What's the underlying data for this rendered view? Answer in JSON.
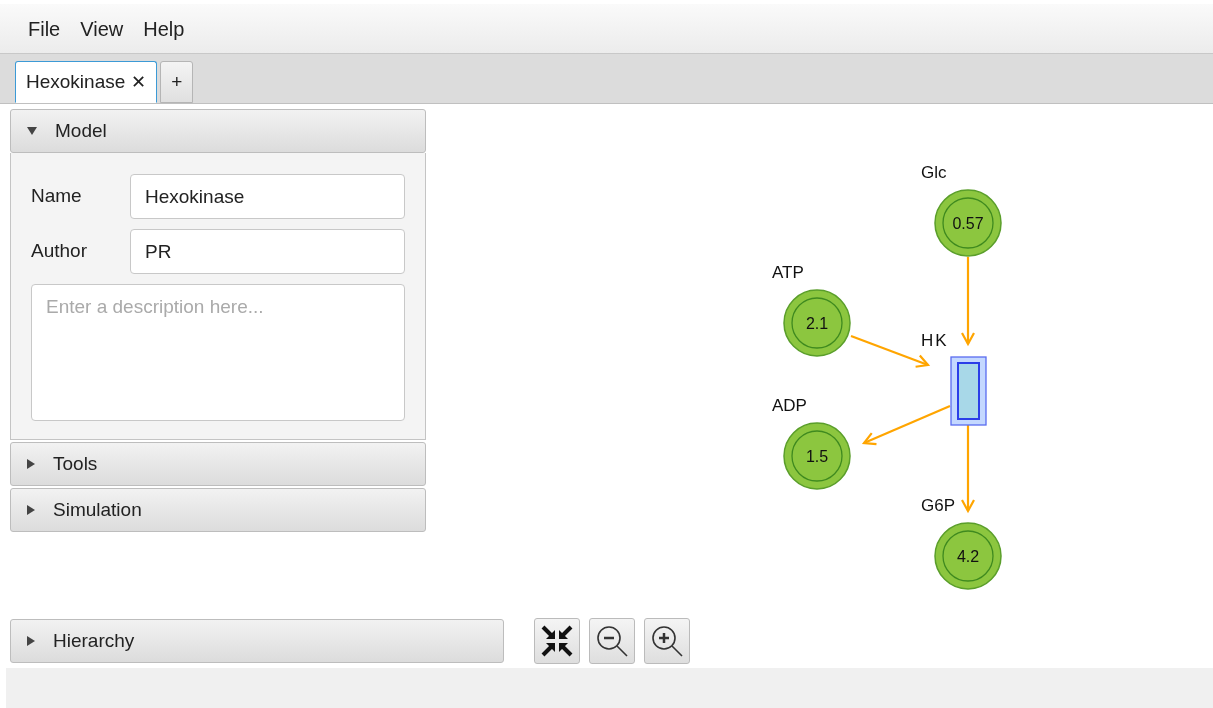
{
  "menu": [
    "File",
    "View",
    "Help"
  ],
  "tabs": [
    {
      "label": "Hexokinase",
      "close": "✕",
      "selected": true
    },
    {
      "label": "+",
      "selected": false
    }
  ],
  "panels": [
    {
      "title": "Model",
      "expanded": true
    },
    {
      "title": "Tools",
      "expanded": false
    },
    {
      "title": "Simulation",
      "expanded": false
    }
  ],
  "model": {
    "name_label": "Name",
    "name_value": "Hexokinase",
    "author_label": "Author",
    "author_value": "PR",
    "description_placeholder": "Enter a description here..."
  },
  "hierarchy": {
    "title": "Hierarchy",
    "expanded": false
  },
  "species": [
    {
      "label": "Glc",
      "value": "0.57"
    },
    {
      "label": "ATP",
      "value": "2.1"
    },
    {
      "label": "ADP",
      "value": "1.5"
    },
    {
      "label": "G6P",
      "value": "4.2"
    }
  ],
  "reactions": [
    {
      "label": "HK"
    }
  ]
}
